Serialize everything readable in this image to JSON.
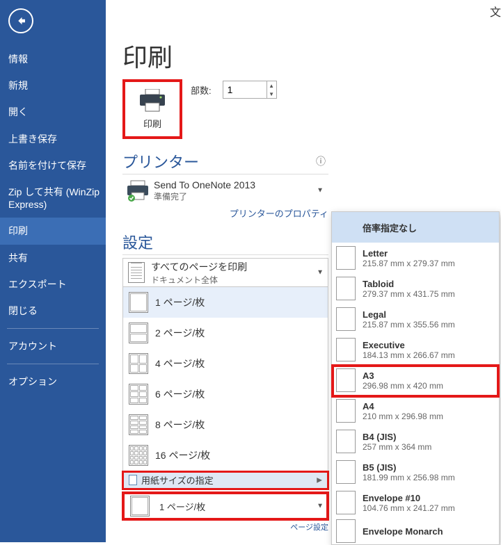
{
  "corner": "文",
  "sidebar": {
    "items": [
      "情報",
      "新規",
      "開く",
      "上書き保存",
      "名前を付けて保存",
      "Zip して共有 (WinZip Express)",
      "印刷",
      "共有",
      "エクスポート",
      "閉じる",
      "アカウント",
      "オプション"
    ],
    "active_index": 6,
    "separator_before": [
      10,
      11
    ]
  },
  "title": "印刷",
  "print_button_label": "印刷",
  "copies_label": "部数:",
  "copies_value": "1",
  "printer_section": "プリンター",
  "printer": {
    "name": "Send To OneNote 2013",
    "status": "準備完了"
  },
  "printer_properties_link": "プリンターのプロパティ",
  "settings_section": "設定",
  "print_range": {
    "line1": "すべてのページを印刷",
    "line2": "ドキュメント全体"
  },
  "pages_per_sheet": [
    {
      "label": "1 ページ/枚",
      "cols": 1,
      "rows": 1
    },
    {
      "label": "2 ページ/枚",
      "cols": 1,
      "rows": 2
    },
    {
      "label": "4 ページ/枚",
      "cols": 2,
      "rows": 2
    },
    {
      "label": "6 ページ/枚",
      "cols": 2,
      "rows": 3
    },
    {
      "label": "8 ページ/枚",
      "cols": 2,
      "rows": 4
    },
    {
      "label": "16 ページ/枚",
      "cols": 4,
      "rows": 4
    }
  ],
  "paper_size_bar": "用紙サイズの指定",
  "final_dd_label": "1 ページ/枚",
  "page_setup_link": "ページ設定",
  "paper_sizes": [
    {
      "name": "倍率指定なし",
      "dims": ""
    },
    {
      "name": "Letter",
      "dims": "215.87 mm x 279.37 mm"
    },
    {
      "name": "Tabloid",
      "dims": "279.37 mm x 431.75 mm"
    },
    {
      "name": "Legal",
      "dims": "215.87 mm x 355.56 mm"
    },
    {
      "name": "Executive",
      "dims": "184.13 mm x 266.67 mm"
    },
    {
      "name": "A3",
      "dims": "296.98 mm x 420 mm"
    },
    {
      "name": "A4",
      "dims": "210 mm x 296.98 mm"
    },
    {
      "name": "B4 (JIS)",
      "dims": "257 mm x 364 mm"
    },
    {
      "name": "B5 (JIS)",
      "dims": "181.99 mm x 256.98 mm"
    },
    {
      "name": "Envelope #10",
      "dims": "104.76 mm x 241.27 mm"
    },
    {
      "name": "Envelope Monarch",
      "dims": ""
    }
  ],
  "highlighted_paper_index": 5
}
